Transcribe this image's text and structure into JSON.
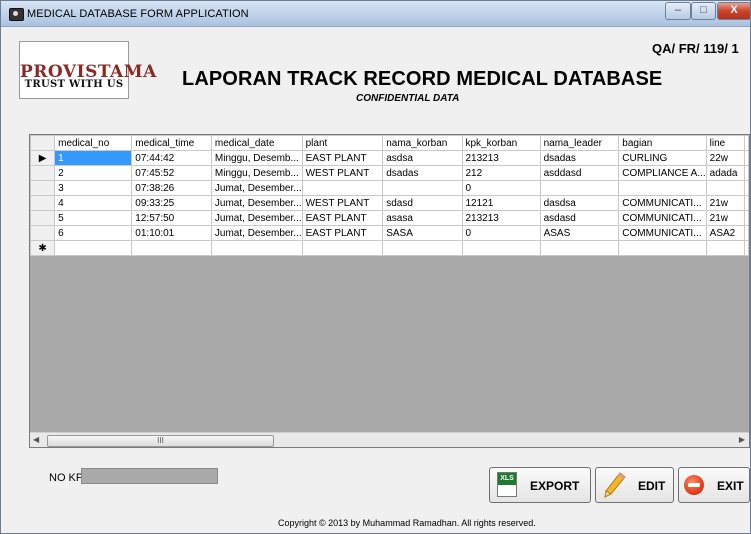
{
  "window": {
    "title": "MEDICAL DATABASE FORM APPLICATION",
    "controls": {
      "minimize": "–",
      "maximize": "□",
      "close": "X"
    }
  },
  "header": {
    "logo_line1": "PROVISTAMA",
    "logo_line2": "TRUST WITH US",
    "doc_number": "QA/ FR/ 119/ 1",
    "title": "LAPORAN TRACK RECORD MEDICAL DATABASE",
    "subtitle": "CONFIDENTIAL DATA"
  },
  "grid": {
    "columns": [
      "medical_no",
      "medical_time",
      "medical_date",
      "plant",
      "nama_korban",
      "kpk_korban",
      "nama_leader",
      "bagian",
      "line"
    ],
    "rows": [
      {
        "marker": "▶",
        "cells": [
          "1",
          "07:44:42",
          "Minggu, Desemb...",
          "EAST PLANT",
          "asdsa",
          "213213",
          "dsadas",
          "CURLING",
          "22w"
        ]
      },
      {
        "marker": "",
        "cells": [
          "2",
          "07:45:52",
          "Minggu, Desemb...",
          "WEST PLANT",
          "dsadas",
          "212",
          "asddasd",
          "COMPLIANCE A...",
          "adada"
        ]
      },
      {
        "marker": "",
        "cells": [
          "3",
          "07:38:26",
          "Jumat, Desember...",
          "",
          "",
          "0",
          "",
          "",
          ""
        ]
      },
      {
        "marker": "",
        "cells": [
          "4",
          "09:33:25",
          "Jumat, Desember...",
          "WEST PLANT",
          "sdasd",
          "12121",
          "dasdsa",
          "COMMUNICATI...",
          "21w"
        ]
      },
      {
        "marker": "",
        "cells": [
          "5",
          "12:57:50",
          "Jumat, Desember...",
          "EAST PLANT",
          "asasa",
          "213213",
          "asdasd",
          "COMMUNICATI...",
          "21w"
        ]
      },
      {
        "marker": "",
        "cells": [
          "6",
          "01:10:01",
          "Jumat, Desember...",
          "EAST PLANT",
          "SASA",
          "0",
          "ASAS",
          "COMMUNICATI...",
          "ASA2"
        ]
      },
      {
        "marker": "✱",
        "cells": [
          "",
          "",
          "",
          "",
          "",
          "",
          "",
          "",
          ""
        ]
      }
    ],
    "scroll_thumb": "III"
  },
  "form": {
    "no_kpk_label": "NO KPK :",
    "no_kpk_value": ""
  },
  "buttons": {
    "export_icon_text": "XLS",
    "export": "EXPORT",
    "edit": "EDIT",
    "exit": "EXIT"
  },
  "footer": {
    "copyright": "Copyright © 2013 by Muhammad Ramadhan. All rights reserved."
  }
}
